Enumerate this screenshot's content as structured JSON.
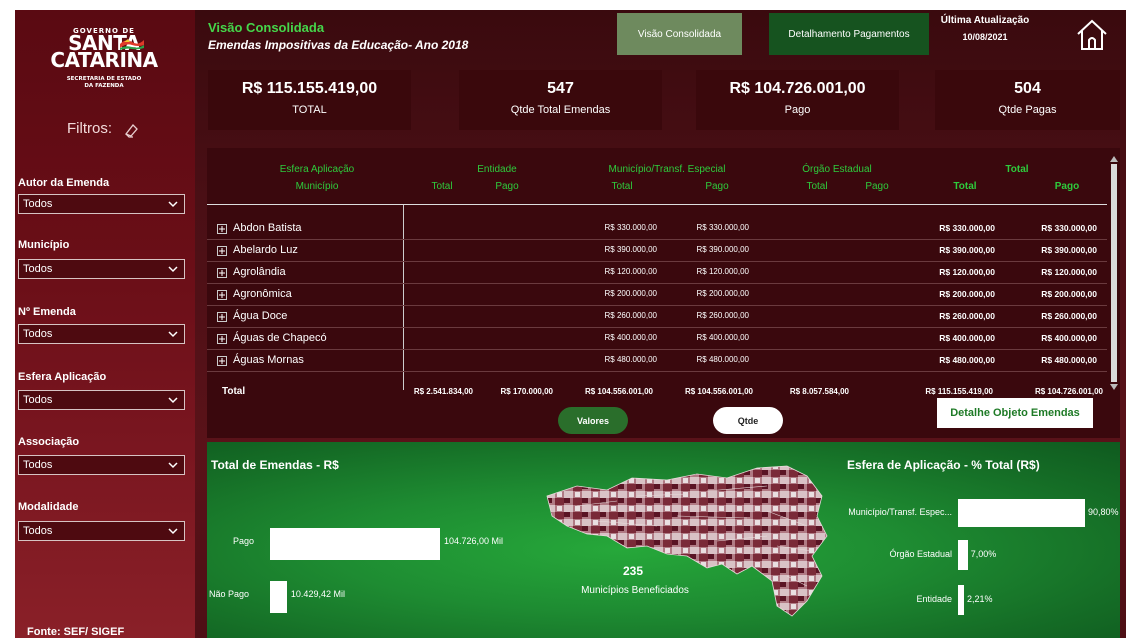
{
  "colors": {
    "accent_green": "#2ecb3c",
    "panel_dark": "#3a080d",
    "sidebar": "#6a0e17",
    "bar": "#ffffff"
  },
  "logo": {
    "gov": "GOVERNO DE",
    "main1": "SANTA",
    "main2": "CATARINA",
    "sub1": "SECRETARIA DE ESTADO",
    "sub2": "DA FAZENDA"
  },
  "sidebar": {
    "filtros": "Filtros:",
    "filters": [
      {
        "label": "Autor da Emenda",
        "value": "Todos"
      },
      {
        "label": "Município",
        "value": "Todos"
      },
      {
        "label": "Nº Emenda",
        "value": "Todos"
      },
      {
        "label": "Esfera Aplicação",
        "value": "Todos"
      },
      {
        "label": "Associação",
        "value": "Todos"
      },
      {
        "label": "Modalidade",
        "value": "Todos"
      }
    ],
    "fonte": "Fonte: SEF/ SIGEF"
  },
  "header": {
    "title": "Visão Consolidada",
    "subtitle": "Emendas Impositivas da Educação- Ano 2018",
    "tab_visao": "Visão Consolidada",
    "tab_detalhamento": "Detalhamento Pagamentos",
    "update_label": "Última Atualização",
    "update_date": "10/08/2021"
  },
  "kpis": [
    {
      "value": "R$ 115.155.419,00",
      "label": "TOTAL"
    },
    {
      "value": "547",
      "label": "Qtde Total Emendas"
    },
    {
      "value": "R$ 104.726.001,00",
      "label": "Pago"
    },
    {
      "value": "504",
      "label": "Qtde Pagas"
    }
  ],
  "table": {
    "h1": {
      "esfera": "Esfera Aplicação",
      "entidade": "Entidade",
      "municipio": "Município/Transf. Especial",
      "orgao": "Órgão Estadual",
      "total": "Total"
    },
    "h2": {
      "municipio": "Município",
      "total": "Total",
      "pago": "Pago"
    },
    "rows": [
      {
        "name": "Abdon Batista",
        "m_total": "R$ 330.000,00",
        "m_pago": "R$ 330.000,00",
        "t_total": "R$ 330.000,00",
        "t_pago": "R$ 330.000,00"
      },
      {
        "name": "Abelardo Luz",
        "m_total": "R$ 390.000,00",
        "m_pago": "R$ 390.000,00",
        "t_total": "R$ 390.000,00",
        "t_pago": "R$ 390.000,00"
      },
      {
        "name": "Agrolândia",
        "m_total": "R$ 120.000,00",
        "m_pago": "R$ 120.000,00",
        "t_total": "R$ 120.000,00",
        "t_pago": "R$ 120.000,00"
      },
      {
        "name": "Agronômica",
        "m_total": "R$ 200.000,00",
        "m_pago": "R$ 200.000,00",
        "t_total": "R$ 200.000,00",
        "t_pago": "R$ 200.000,00"
      },
      {
        "name": "Água Doce",
        "m_total": "R$ 260.000,00",
        "m_pago": "R$ 260.000,00",
        "t_total": "R$ 260.000,00",
        "t_pago": "R$ 260.000,00"
      },
      {
        "name": "Águas de Chapecó",
        "m_total": "R$ 400.000,00",
        "m_pago": "R$ 400.000,00",
        "t_total": "R$ 400.000,00",
        "t_pago": "R$ 400.000,00"
      },
      {
        "name": "Águas Mornas",
        "m_total": "R$ 480.000,00",
        "m_pago": "R$ 480.000,00",
        "t_total": "R$ 480.000,00",
        "t_pago": "R$ 480.000,00"
      }
    ],
    "total_row": {
      "label": "Total",
      "e_total": "R$ 2.541.834,00",
      "e_pago": "R$ 170.000,00",
      "m_total": "R$ 104.556.001,00",
      "m_pago": "R$ 104.556.001,00",
      "o_total": "R$ 8.057.584,00",
      "t_total": "R$ 115.155.419,00",
      "t_pago": "R$ 104.726.001,00"
    },
    "btn_valores": "Valores",
    "btn_qtde": "Qtde",
    "btn_detalhe": "Detalhe Objeto Emendas"
  },
  "chart_total": {
    "title": "Total de Emendas - R$",
    "type": "bar",
    "categories": [
      "Pago",
      "Não Pago"
    ],
    "values": [
      104726.0,
      10429.42
    ],
    "labels": [
      "104.726,00 Mil",
      "10.429,42 Mil"
    ]
  },
  "map": {
    "count": "235",
    "label": "Municípios Beneficiados"
  },
  "chart_esfera": {
    "title": "Esfera de Aplicação - % Total (R$)",
    "type": "bar",
    "categories": [
      "Município/Transf. Espec...",
      "Órgão Estadual",
      "Entidade"
    ],
    "values": [
      90.8,
      7.0,
      2.21
    ],
    "labels": [
      "90,80%",
      "7,00%",
      "2,21%"
    ]
  }
}
